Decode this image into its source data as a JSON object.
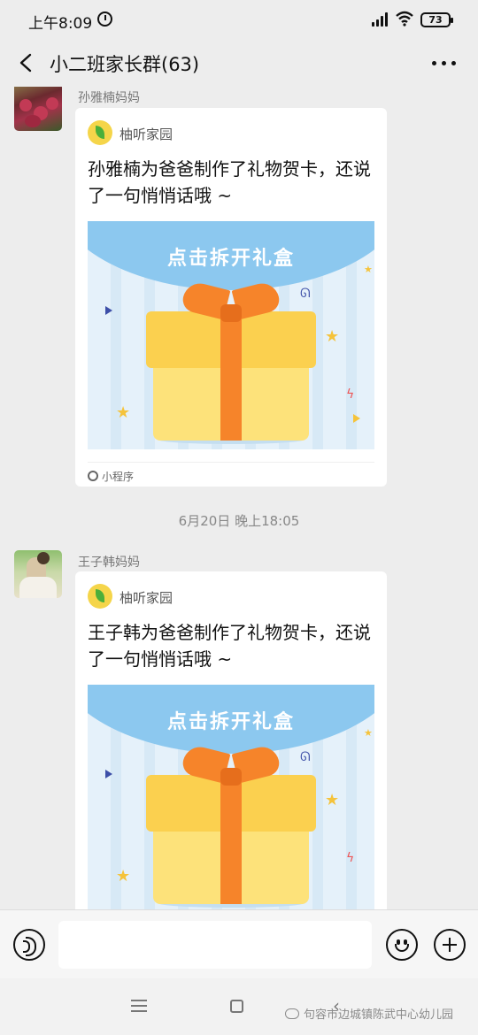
{
  "status_bar": {
    "time": "上午8:09",
    "battery": "73"
  },
  "header": {
    "title": "小二班家长群(63)"
  },
  "messages": [
    {
      "sender": "孙雅楠妈妈",
      "card": {
        "app_name": "柚听家园",
        "text": "孙雅楠为爸爸制作了礼物贺卡，还说了一句悄悄话哦 ~",
        "cover_title": "点击拆开礼盒",
        "footer": "小程序"
      }
    },
    {
      "sender": "王子韩妈妈",
      "card": {
        "app_name": "柚听家园",
        "text": "王子韩为爸爸制作了礼物贺卡，还说了一句悄悄话哦 ~",
        "cover_title": "点击拆开礼盒"
      }
    }
  ],
  "timestamp": "6月20日 晚上18:05",
  "input_bar": {
    "placeholder": ""
  },
  "watermark": "句容市边城镇陈武中心幼儿园",
  "colors": {
    "background": "#ededed",
    "card": "#ffffff",
    "gift_box": "#fbd04f",
    "ribbon": "#f6842a",
    "cover_arc": "#8cc8ef"
  },
  "icons": [
    "back-icon",
    "more-icon",
    "alarm-icon",
    "signal-icon",
    "wifi-icon",
    "battery-icon",
    "voice-icon",
    "emoji-icon",
    "plus-icon",
    "link-icon",
    "app-logo-icon"
  ]
}
